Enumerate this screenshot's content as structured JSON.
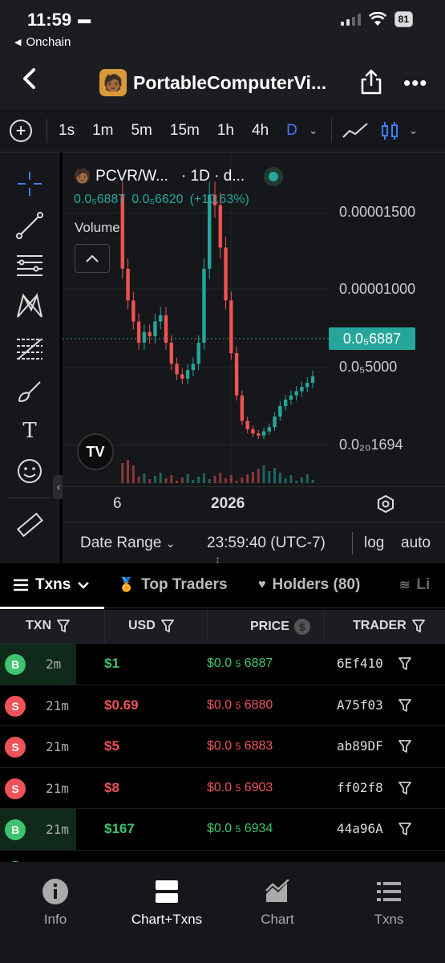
{
  "status": {
    "time": "11:59",
    "back_app": "Onchain",
    "battery": "81"
  },
  "header": {
    "title": "PortableComputerVi...",
    "avatar_emoji": "🧑🏾"
  },
  "timeframes": [
    "1s",
    "1m",
    "5m",
    "15m",
    "1h",
    "4h",
    "D"
  ],
  "active_timeframe": "D",
  "chart": {
    "symbol": "PCVR/W...",
    "interval": "· 1D · d...",
    "open": "0.0₅6887",
    "close": "0.0₅6620",
    "change": "(+10.63%)",
    "volume_label": "Volume",
    "y_labels": [
      "0.00001500",
      "0.00001000",
      "0.0₅5000",
      "0.0₂₀1694"
    ],
    "current_price": "0.0₅6887",
    "x_labels": [
      "6",
      "2026"
    ],
    "date_range_label": "Date Range",
    "time_label": "23:59:40 (UTC-7)",
    "log_label": "log",
    "auto_label": "auto",
    "colors": {
      "up": "#26a69a",
      "down": "#ef5350",
      "background": "#16171b"
    }
  },
  "chart_data": {
    "type": "line",
    "title": "",
    "xlabel": "",
    "ylabel": "",
    "x_ticks": [
      "6",
      "2026"
    ],
    "series": [
      {
        "values": [
          1.55e-05,
          1.2e-05,
          1.05e-05,
          9.5e-06,
          8.5e-06,
          9e-06,
          8.8e-06,
          9.5e-06,
          9.8e-06,
          8.5e-06,
          7.5e-06,
          7e-06,
          6.8e-06,
          7.2e-06,
          7.5e-06,
          8.5e-06,
          1.2e-05,
          1.55e-05,
          1.5e-05,
          1.3e-05,
          1.05e-05,
          8e-06,
          6e-06,
          4.8e-06,
          4.4e-06,
          4.2e-06,
          4.1e-06,
          4.3e-06,
          4.5e-06,
          5e-06,
          5.5e-06,
          5.8e-06,
          6e-06,
          6.2e-06,
          6.4e-06,
          6.6e-06,
          6.9e-06
        ]
      }
    ],
    "ylim": [
      1.7e-06,
      1.75e-05
    ]
  },
  "tabs": [
    {
      "label": "Txns",
      "active": true
    },
    {
      "label": "Top Traders"
    },
    {
      "label": "Holders (80)"
    },
    {
      "label": "Li"
    }
  ],
  "table": {
    "headers": [
      "TXN",
      "USD",
      "PRICE",
      "TRADER"
    ],
    "rows": [
      {
        "type": "B",
        "age": "2m",
        "usd": "$1",
        "price_prefix": "$0.0",
        "price_sub": "5",
        "price": "6887",
        "trader": "6Ef410"
      },
      {
        "type": "S",
        "age": "21m",
        "usd": "$0.69",
        "price_prefix": "$0.0",
        "price_sub": "5",
        "price": "6880",
        "trader": "A75f03"
      },
      {
        "type": "S",
        "age": "21m",
        "usd": "$5",
        "price_prefix": "$0.0",
        "price_sub": "5",
        "price": "6883",
        "trader": "ab89DF"
      },
      {
        "type": "S",
        "age": "21m",
        "usd": "$8",
        "price_prefix": "$0.0",
        "price_sub": "5",
        "price": "6903",
        "trader": "ff02f8"
      },
      {
        "type": "B",
        "age": "21m",
        "usd": "$167",
        "price_prefix": "$0.0",
        "price_sub": "5",
        "price": "6934",
        "trader": "44a96A"
      }
    ]
  },
  "bottom_nav": [
    {
      "label": "Info",
      "icon": "info-icon"
    },
    {
      "label": "Chart+Txns",
      "icon": "split-view-icon",
      "active": true
    },
    {
      "label": "Chart",
      "icon": "chart-icon"
    },
    {
      "label": "Txns",
      "icon": "list-icon"
    }
  ]
}
